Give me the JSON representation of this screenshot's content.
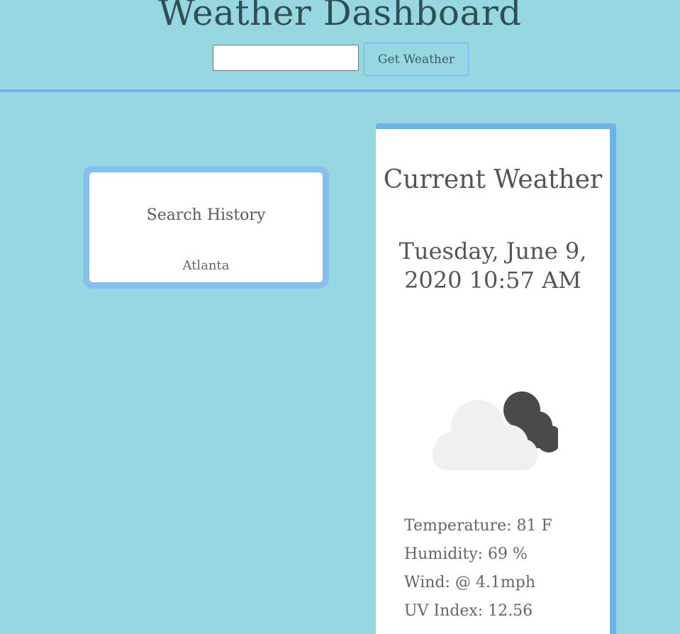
{
  "header": {
    "title": "Weather Dashboard",
    "search_value": "",
    "search_placeholder": "",
    "button_label": "Get Weather"
  },
  "history": {
    "title": "Search History",
    "items": [
      "Atlanta"
    ]
  },
  "current": {
    "title": "Current Weather",
    "date": "Tuesday, June 9, 2020 10:57 AM",
    "icon": "partly-cloudy-icon",
    "stats": {
      "temperature": "Temperature: 81 F",
      "humidity": "Humidity: 69 %",
      "wind": "Wind: @ 4.1mph",
      "uv_index": "UV Index: 12.56"
    }
  },
  "colors": {
    "page_background": "#97d7e1",
    "accent_border": "#6ab4e6",
    "history_border": "#84bfee",
    "card_background": "#ffffff",
    "cloud_light": "#f0f0ef",
    "cloud_dark": "#4a4a4c"
  }
}
